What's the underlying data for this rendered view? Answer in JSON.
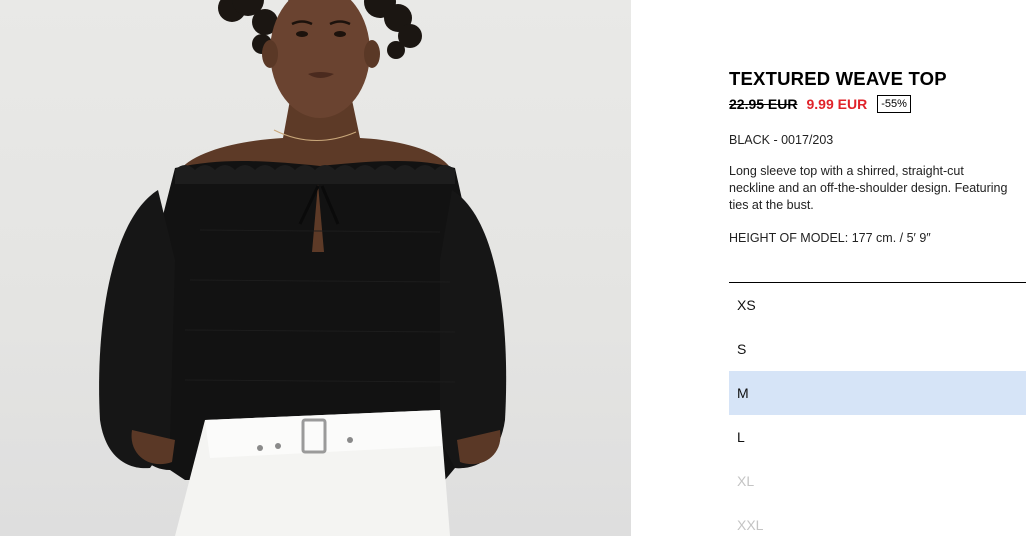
{
  "product": {
    "title": "TEXTURED WEAVE TOP",
    "old_price": "22.95 EUR",
    "new_price": "9.99 EUR",
    "discount": "-55%",
    "color_ref": "BLACK - 0017/203",
    "description": "Long sleeve top with a shirred, straight-cut neckline and an off-the-shoulder design. Featuring ties at the bust.",
    "model_height": "HEIGHT OF MODEL: 177 cm. / 5′ 9″"
  },
  "sizes": [
    {
      "label": "XS",
      "state": "available"
    },
    {
      "label": "S",
      "state": "available"
    },
    {
      "label": "M",
      "state": "selected"
    },
    {
      "label": "L",
      "state": "available"
    },
    {
      "label": "XL",
      "state": "unavailable"
    },
    {
      "label": "XXL",
      "state": "unavailable"
    }
  ],
  "colors": {
    "sale_red": "#e0232a",
    "selected_highlight": "#d6e4f7",
    "unavailable_text": "#c4c4c4"
  }
}
